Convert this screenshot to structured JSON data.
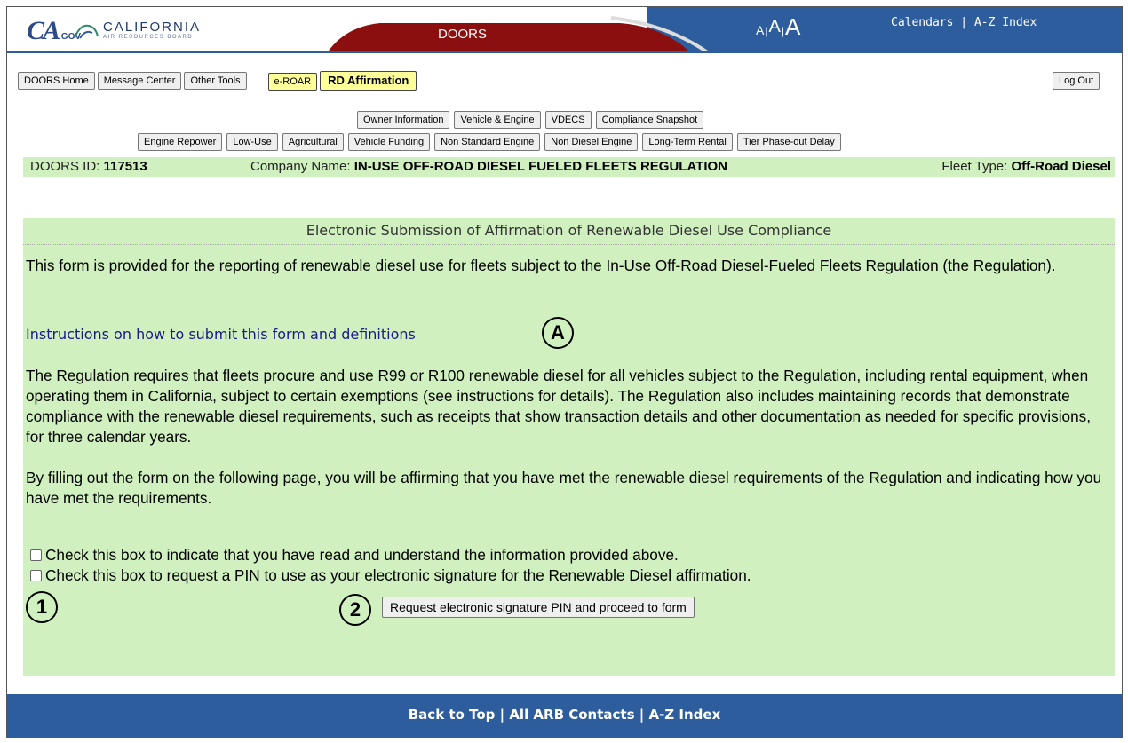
{
  "header": {
    "logo_ca": "CA",
    "logo_gov": ".GOV",
    "logo_name": "CALIFORNIA",
    "logo_sub": "AIR RESOURCES BOARD",
    "doors_tab": "DOORS",
    "font_small": "A",
    "font_medium": "A",
    "font_large": "A",
    "font_sep": "|",
    "calendars": "Calendars",
    "link_sep": " | ",
    "az_index": "A-Z Index"
  },
  "nav": {
    "doors_home": "DOORS Home",
    "message_center": "Message Center",
    "other_tools": "Other Tools",
    "eroar": "e-ROAR",
    "rd_affirmation": "RD Affirmation",
    "logout": "Log Out"
  },
  "subnav": {
    "row1": [
      "Owner Information",
      "Vehicle & Engine",
      "VDECS",
      "Compliance Snapshot"
    ],
    "row2": [
      "Engine Repower",
      "Low-Use",
      "Agricultural",
      "Vehicle Funding",
      "Non Standard Engine",
      "Non Diesel Engine",
      "Long-Term Rental",
      "Tier Phase-out Delay"
    ]
  },
  "info": {
    "doors_id_label": "DOORS ID: ",
    "doors_id": "117513",
    "company_label": "Company Name: ",
    "company": "IN-USE OFF-ROAD DIESEL FUELED FLEETS REGULATION",
    "fleet_label": "Fleet Type: ",
    "fleet": "Off-Road Diesel"
  },
  "main": {
    "title": "Electronic Submission of Affirmation of Renewable Diesel Use Compliance",
    "intro": "This form is provided for the reporting of renewable diesel use for fleets subject to the In-Use Off-Road Diesel-Fueled Fleets Regulation (the Regulation).",
    "instructions_link": "Instructions on how to submit this form and definitions",
    "requirements": "The Regulation requires that fleets procure and use R99 or R100 renewable diesel for all vehicles subject to the Regulation, including rental equipment, when operating them in California, subject to certain exemptions (see instructions for details). The Regulation also includes maintaining records that demonstrate compliance with the renewable diesel requirements, such as receipts that show transaction details and other documentation as needed for specific provisions, for three calendar years.",
    "affirm": "By filling out the form on the following page, you will be affirming that you have met the renewable diesel requirements of the Regulation and indicating how you have met the requirements.",
    "check1": "Check this box to indicate that you have read and understand the information provided above.",
    "check1_checked": false,
    "check2": "Check this box to request a PIN to use as your electronic signature for the Renewable Diesel affirmation.",
    "check2_checked": false,
    "proceed_button": "Request electronic signature PIN and proceed to form"
  },
  "markers": {
    "a": "A",
    "one": "1",
    "two": "2"
  },
  "footer": {
    "back_to_top": "Back to Top",
    "sep": " | ",
    "all_contacts": "All ARB Contacts",
    "az_index": "A-Z Index"
  },
  "colors": {
    "header_blue": "#2e5d9e",
    "doors_red": "#8b0f0f",
    "panel_green": "#d0f0c0",
    "button_yellow": "#ffff99"
  }
}
